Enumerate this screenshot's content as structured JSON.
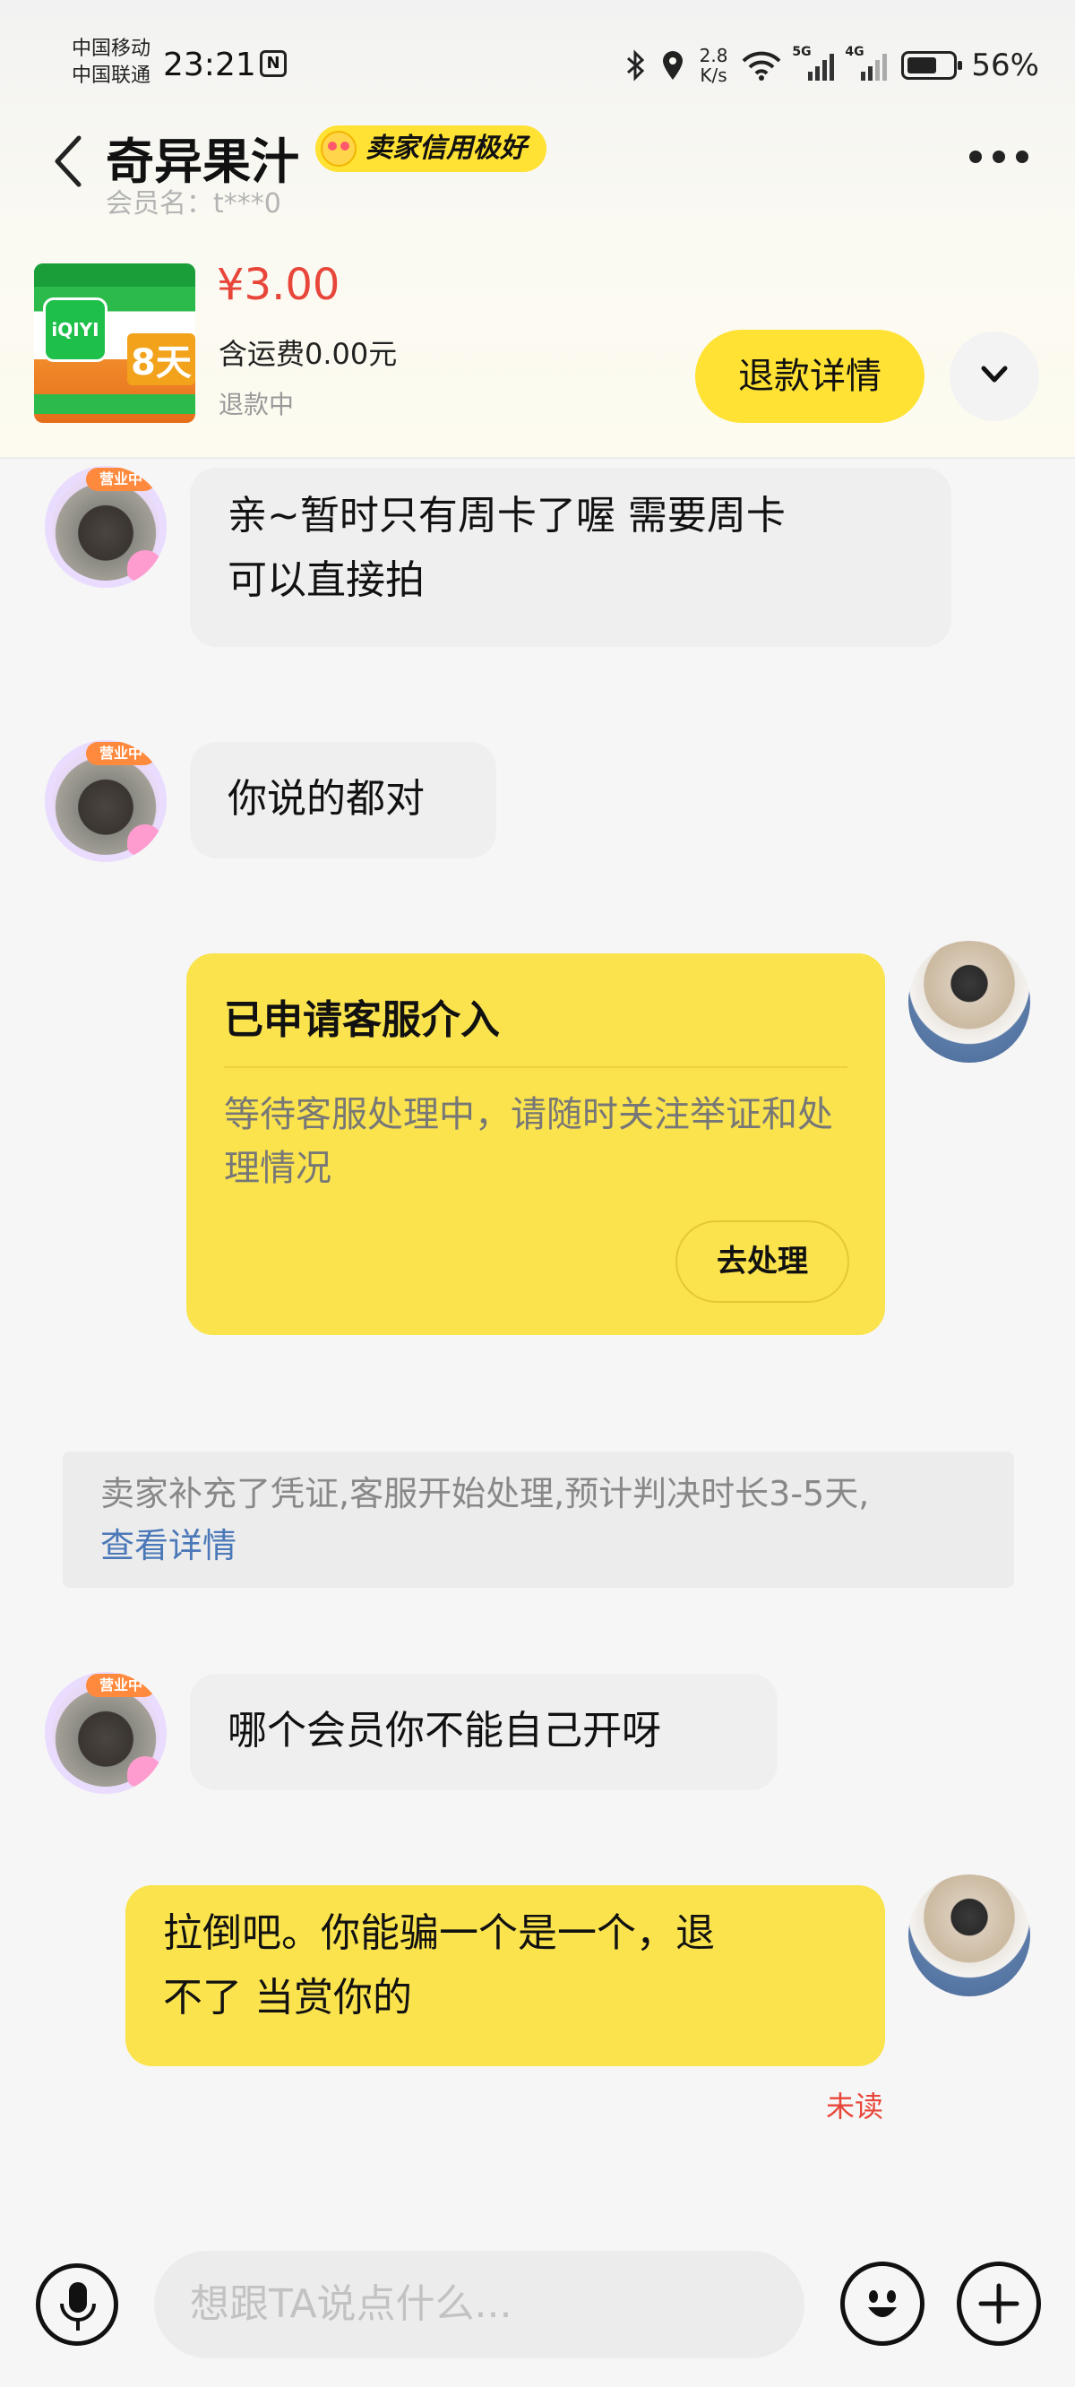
{
  "status_bar": {
    "carrier_1": "中国移动",
    "carrier_2": "中国联通",
    "time": "23:21",
    "nfc_label": "N",
    "net_speed_value": "2.8",
    "net_speed_unit": "K/s",
    "sig1_tag": "5G",
    "sig2_tag": "4G",
    "battery_percent": "56%",
    "battery_level": 0.56
  },
  "header": {
    "shop_name": "奇异果汁",
    "credit_badge": "卖家信用极好",
    "member_label": "会员名：t***0"
  },
  "product": {
    "thumb_logo": "iQIYI",
    "thumb_days": "8天",
    "price": "¥3.00",
    "shipping": "含运费0.00元",
    "status": "退款中",
    "refund_button": "退款详情"
  },
  "messages": [
    {
      "side": "left",
      "text_line1": "亲~暂时只有周卡了喔 需要周卡",
      "text_line2": "可以直接拍"
    },
    {
      "side": "left",
      "text_line1": "你说的都对"
    },
    {
      "side": "left",
      "text_line1": "哪个会员你不能自己开呀"
    },
    {
      "side": "right",
      "text_line1": "拉倒吧。你能骗一个是一个，退",
      "text_line2": "不了 当赏你的",
      "read_status": "未读"
    }
  ],
  "service_card": {
    "title": "已申请客服介入",
    "description": "等待客服处理中，请随时关注举证和处理情况",
    "button": "去处理"
  },
  "system_notice": {
    "text": "卖家补充了凭证,客服开始处理,预计判决时长3-5天,",
    "link": "查看详情"
  },
  "avatar_badge": "营业中",
  "input_bar": {
    "placeholder": "想跟TA说点什么..."
  }
}
